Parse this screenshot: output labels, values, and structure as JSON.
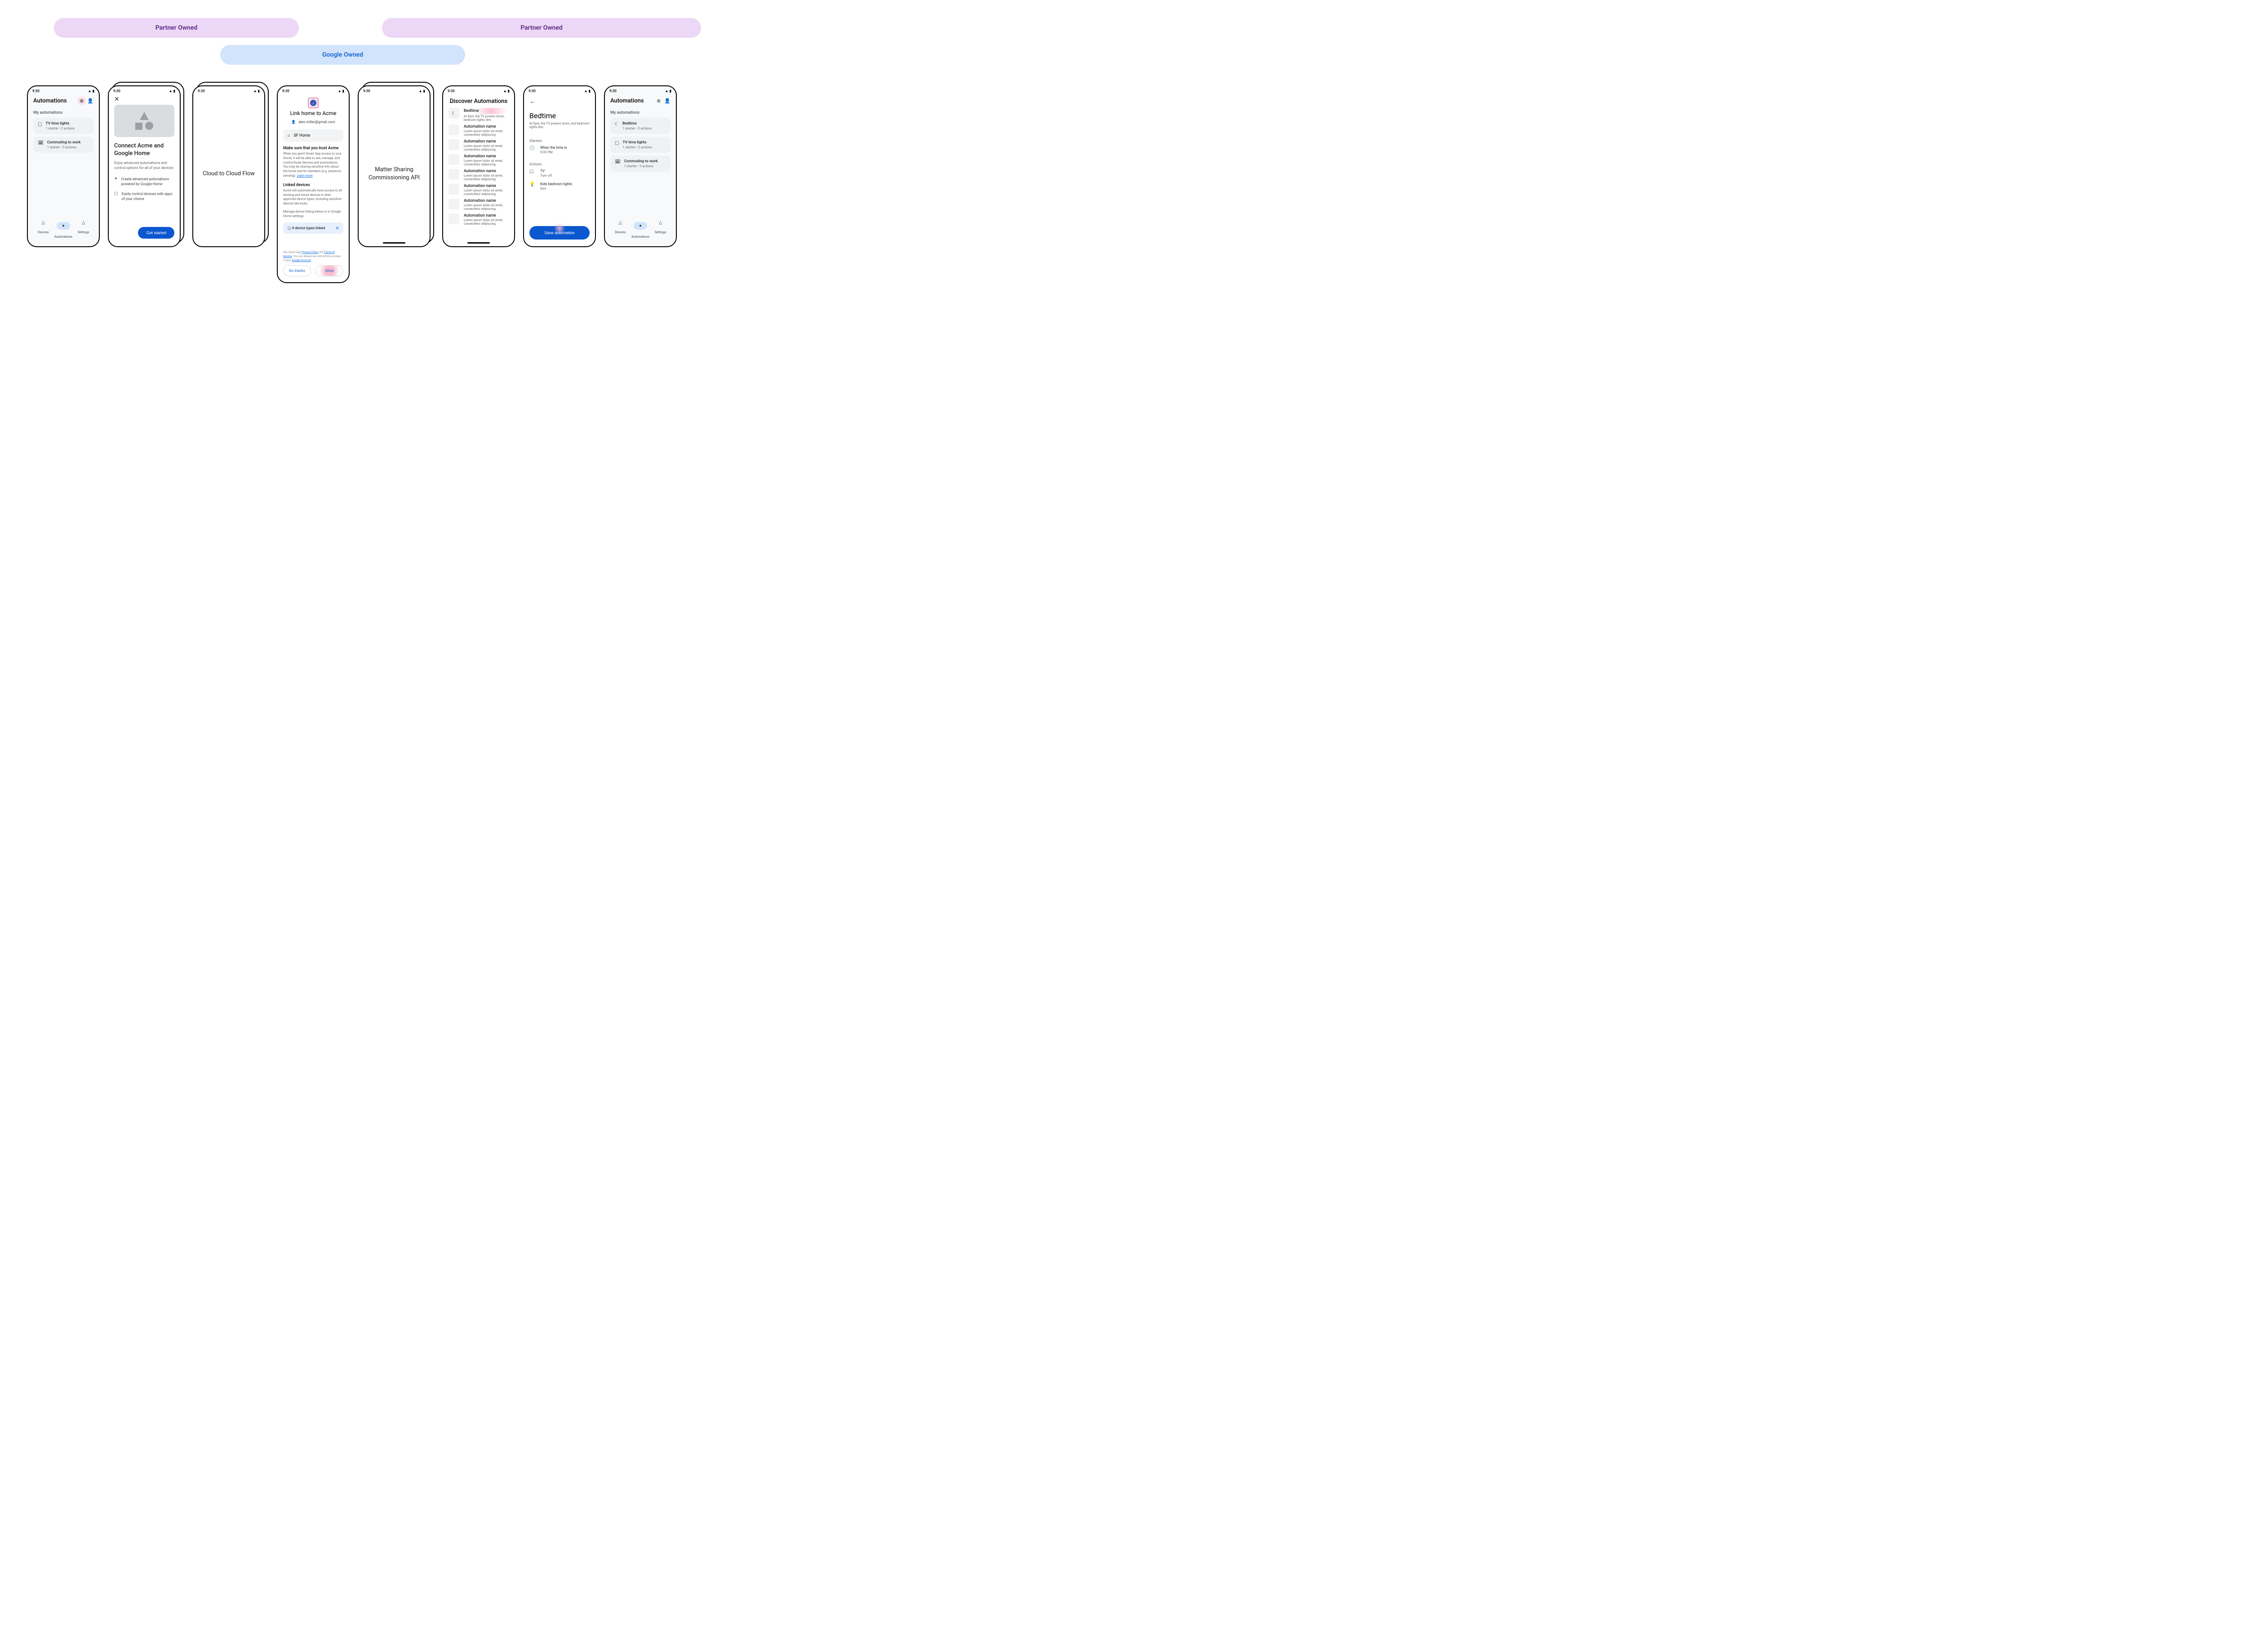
{
  "banners": {
    "partner1": "Partner Owned",
    "google": "Google Owned",
    "partner2": "Partner Owned"
  },
  "status": {
    "time": "9:30"
  },
  "screen1": {
    "title": "Automations",
    "section": "My automations",
    "items": [
      {
        "icon": "▢",
        "title": "TV time lights",
        "sub": "1 starter • 2 actions"
      },
      {
        "icon": "🗓",
        "title": "Commuting to work",
        "sub": "1 starter • 3 actions"
      }
    ],
    "nav": {
      "devices": "Devices",
      "automations": "Automations",
      "settings": "Settings"
    }
  },
  "screen2": {
    "title": "Connect Acme and Google Home",
    "sub": "Enjoy advanced automations and control options for all of your devices",
    "feat1": "Create advanced automations powered by Google Home",
    "feat2": "Easily control devices with apps of your choice",
    "cta": "Get started"
  },
  "screen3": {
    "label": "Cloud to Cloud Flow"
  },
  "screen4": {
    "title": "Link home to Acme",
    "email": "alex.miller@gmail.com",
    "home": "SF Home",
    "trustTitle": "Make sure that you trust Acme",
    "trustText": "When you grant Smart App access to your Home, it will be able to  see, manage, and control those devices and automations. You may be sharing sensitive info about the home and its members (e.g. presence sensing). ",
    "trustLink": "Learn more",
    "linkedTitle": "Linked devices",
    "linkedText": "Acme will automatically have access to all existing and future devices in their approved device types, including sensitive devices like locks.",
    "manageText": "Manage device linking below or in Google Home settings.",
    "devicesRow": "4 device types linked",
    "legal1": "See Smart App ",
    "legalPrivacy": "Privacy Policy",
    "legalAnd": " and ",
    "legalTos": "Terms of Service",
    "legal2": ". You can always see and remove access in your ",
    "legalAccount": "Google Account",
    "noThanks": "No thanks",
    "allow": "Allow"
  },
  "screen5": {
    "label": "Matter Sharing Commissioning API"
  },
  "screen6": {
    "title": "Discover Automations",
    "items": [
      {
        "icon": "moon",
        "title": "Bedtime",
        "sub": "At 9pm, the TV powers down, bedroom lights dim."
      },
      {
        "title": "Automation name",
        "sub": "Lorem ipsum dolor sit amet, consectetur adipiscing."
      },
      {
        "title": "Automation name",
        "sub": "Lorem ipsum dolor sit amet, consectetur adipiscing."
      },
      {
        "title": "Automation name",
        "sub": "Lorem ipsum dolor sit amet, consectetur adipiscing."
      },
      {
        "title": "Automation name",
        "sub": "Lorem ipsum dolor sit amet, consectetur adipiscing."
      },
      {
        "title": "Automation name",
        "sub": "Lorem ipsum dolor sit amet, consectetur adipiscing."
      },
      {
        "title": "Automation name",
        "sub": "Lorem ipsum dolor sit amet, consectetur adipiscing."
      },
      {
        "title": "Automation name",
        "sub": "Lorem ipsum dolor sit amet, consectetur adipiscing."
      }
    ]
  },
  "screen7": {
    "title": "Bedtime",
    "sub": "At 9pm, the TV powers down, and bedroom lights dim.",
    "startersLabel": "Starters",
    "starter": {
      "l1": "When the time is",
      "l2": "9:00 PM"
    },
    "actionsLabel": "Actions",
    "action1": {
      "l1": "TV",
      "l2": "Turn off"
    },
    "action2": {
      "l1": "Kids bedroom lights",
      "l2": "Dim"
    },
    "cta": "Save automation"
  },
  "screen8": {
    "title": "Automations",
    "section": "My automations",
    "items": [
      {
        "icon": "☾",
        "title": "Bedtime",
        "sub": "1 starter • 2 actions"
      },
      {
        "icon": "▢",
        "title": "TV time lights",
        "sub": "1 starter • 2 actions"
      },
      {
        "icon": "🗓",
        "title": "Commuting to work",
        "sub": "1 starter • 3 actions"
      }
    ],
    "nav": {
      "devices": "Devices",
      "automations": "Automations",
      "settings": "Settings"
    }
  }
}
